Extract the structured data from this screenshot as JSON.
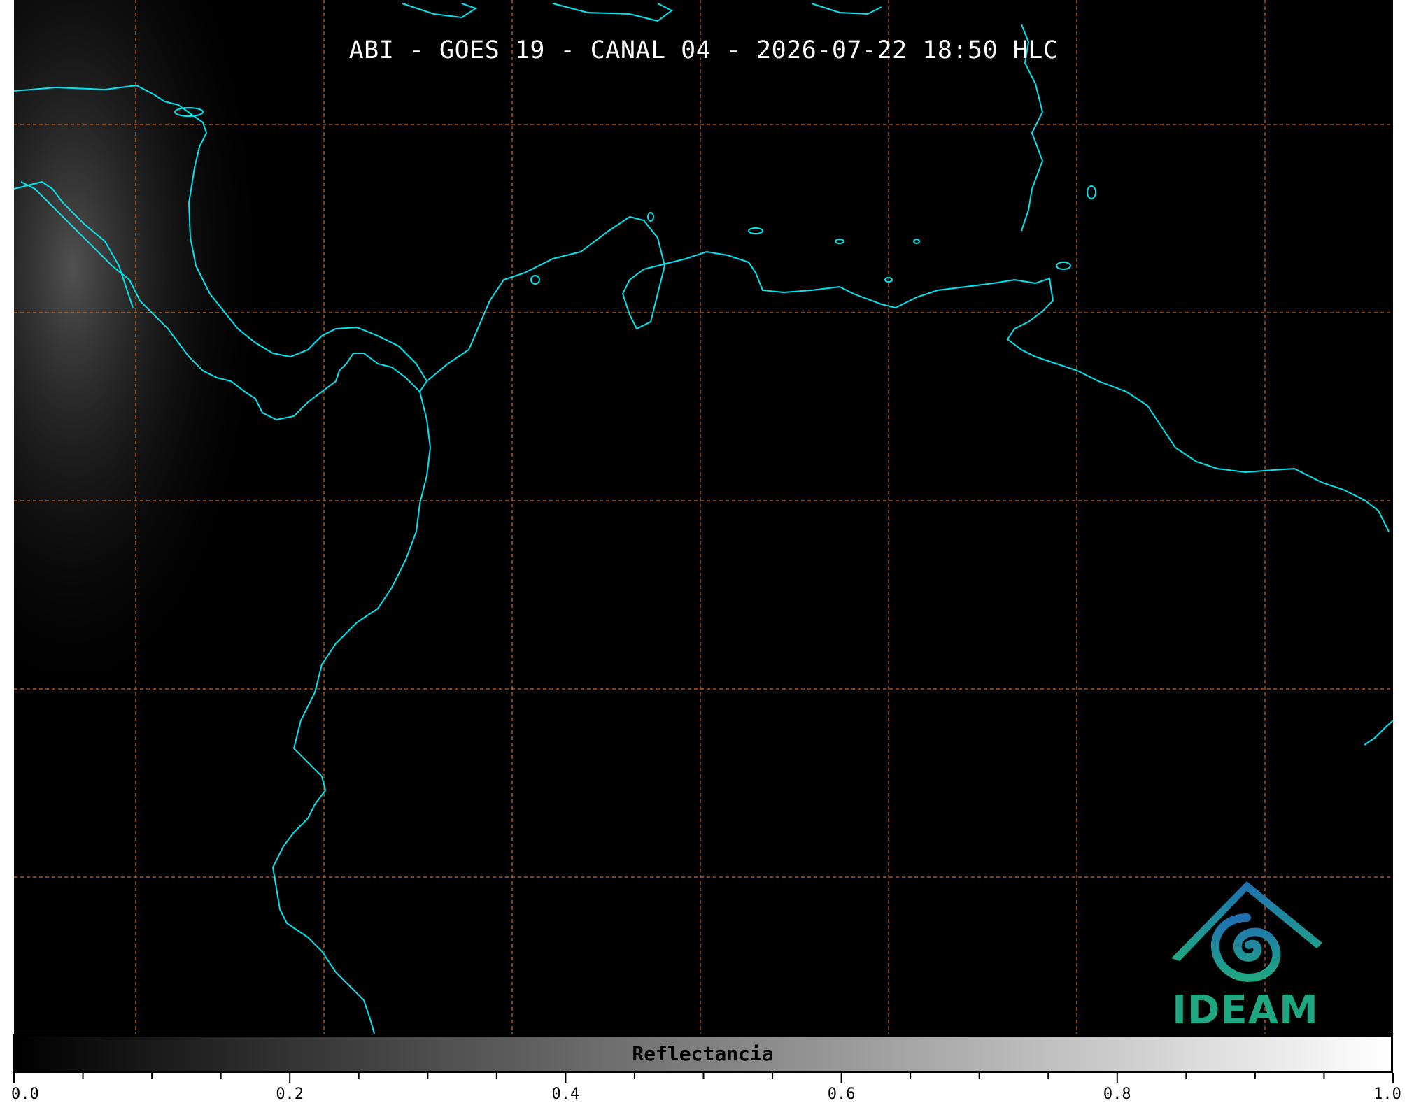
{
  "title": "ABI - GOES 19 - CANAL 04 - 2026-07-22 18:50 HLC",
  "colors": {
    "background": "#000000",
    "coastline": "#00e5ee",
    "gridline": "#d2691e",
    "logo_green": "#1fa782",
    "logo_blue": "#1f6fb2"
  },
  "map": {
    "grid": "dashed",
    "coastlines": "cyan"
  },
  "colorbar": {
    "label": "Reflectancia",
    "range": [
      0.0,
      1.0
    ],
    "colormap": "grayscale",
    "tick_labels": [
      "0.0",
      "0.2",
      "0.4",
      "0.6",
      "0.8",
      "1.0"
    ]
  },
  "logo": {
    "text": "IDEAM",
    "icon": "ideam-mountain-spiral-icon"
  }
}
